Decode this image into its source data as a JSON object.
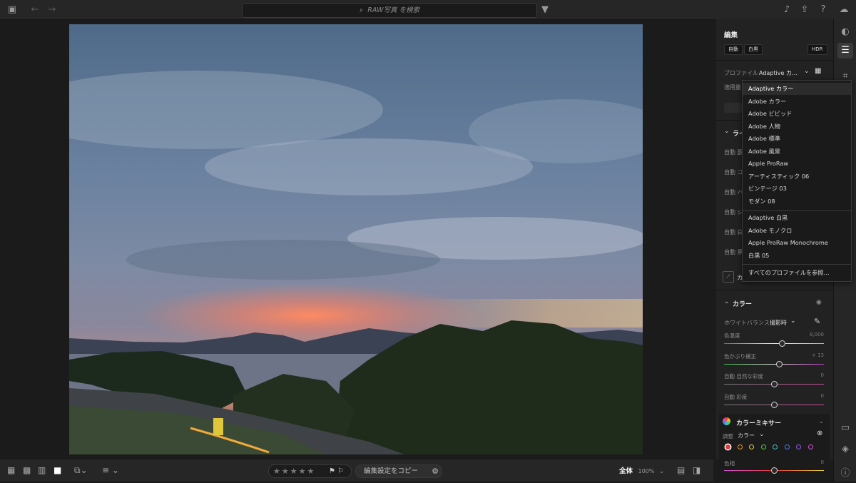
{
  "search": {
    "placeholder": "RAW写真 を検索"
  },
  "bottom": {
    "stars": "★★★★★",
    "flags": "⚑ ⚐",
    "copy_label": "編集設定をコピー",
    "zoom_label": "全体",
    "zoom_value": "100%"
  },
  "edit": {
    "title": "編集",
    "buttons": {
      "auto": "自動",
      "bw": "白黒",
      "hdr": "HDR"
    },
    "profile_label": "プロファイル",
    "profile_value": "Adaptive カ…",
    "amount_label": "適用量",
    "light_section": "ライ",
    "light_rows": [
      "自動 露",
      "自動 コ",
      "自動 ハ",
      "自動 シ",
      "自動 白",
      "自動 黒"
    ],
    "curve_partial": "カ"
  },
  "dropdown": {
    "items": [
      "Adaptive カラー",
      "Adobe カラー",
      "Adobe ビビッド",
      "Adobe 人物",
      "Adobe 標準",
      "Adobe 風景",
      "Apple ProRaw",
      "アーティスティック 06",
      "ビンテージ 03",
      "モダン 08"
    ],
    "items_bw": [
      "Adaptive 白黒",
      "Adobe モノクロ",
      "Apple ProRaw Monochrome",
      "白黒 05"
    ],
    "browse": "すべてのプロファイルを参照…",
    "selected": "Adaptive カラー"
  },
  "color": {
    "title": "カラー",
    "wb_label": "ホワイトバランス",
    "wb_value": "撮影時",
    "sliders": [
      {
        "label": "色温度",
        "value": "8,000",
        "pos": 0.58
      },
      {
        "label": "色かぶり補正",
        "value": "+ 13",
        "pos": 0.55
      },
      {
        "label": "自動 自然な彩度",
        "value": "0",
        "pos": 0.5
      },
      {
        "label": "自動 彩度",
        "value": "0",
        "pos": 0.5
      }
    ]
  },
  "mixer": {
    "title": "カラーミキサー",
    "adjust_label": "調整",
    "adjust_value": "カラー",
    "colors": [
      "#e23b3b",
      "#f0932b",
      "#e6d23a",
      "#4fcf4f",
      "#3ec4c4",
      "#4a7df0",
      "#8a5cf0",
      "#d64fd6"
    ],
    "hue_label": "色相",
    "hue_value": "0"
  }
}
